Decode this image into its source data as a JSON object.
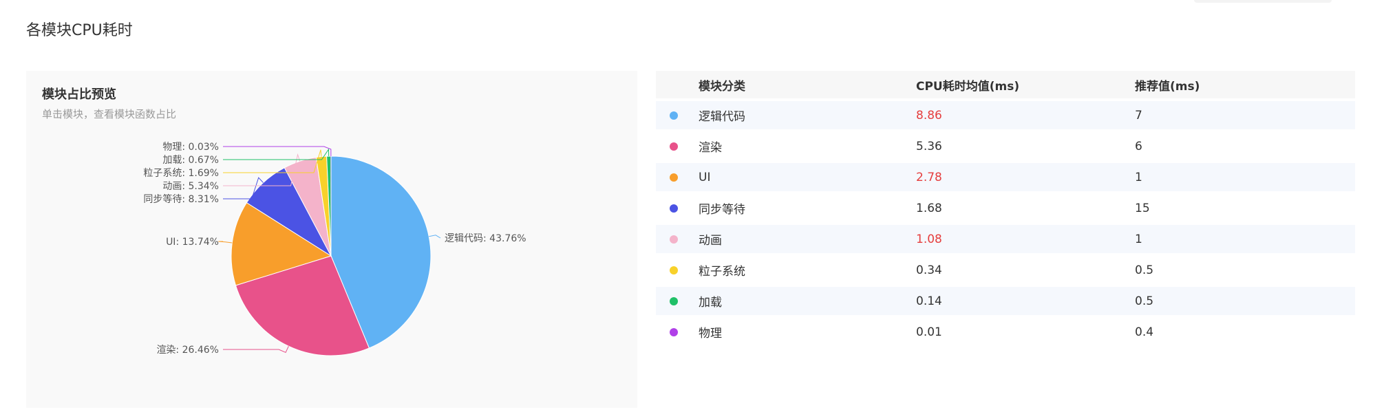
{
  "page": {
    "title": "各模块CPU耗时"
  },
  "card": {
    "title": "模块占比预览",
    "subtitle": "单击模块，查看模块函数占比"
  },
  "chart_data": {
    "type": "pie",
    "title": "模块占比预览",
    "subtitle": "单击模块，查看模块函数占比",
    "slices": [
      {
        "name": "逻辑代码",
        "percent": 43.76,
        "label": "逻辑代码: 43.76%",
        "color": "#60b2f4"
      },
      {
        "name": "渲染",
        "percent": 26.46,
        "label": "渲染: 26.46%",
        "color": "#e8528a"
      },
      {
        "name": "UI",
        "percent": 13.74,
        "label": "UI: 13.74%",
        "color": "#f89e2b"
      },
      {
        "name": "同步等待",
        "percent": 8.31,
        "label": "同步等待: 8.31%",
        "color": "#4b53e4"
      },
      {
        "name": "动画",
        "percent": 5.34,
        "label": "动画: 5.34%",
        "color": "#f4b3ca"
      },
      {
        "name": "粒子系统",
        "percent": 1.69,
        "label": "粒子系统: 1.69%",
        "color": "#f8d12a"
      },
      {
        "name": "加载",
        "percent": 0.67,
        "label": "加载: 0.67%",
        "color": "#20c068"
      },
      {
        "name": "物理",
        "percent": 0.03,
        "label": "物理: 0.03%",
        "color": "#b040e8"
      }
    ]
  },
  "table": {
    "headers": {
      "name": "模块分类",
      "avg": "CPU耗时均值(ms)",
      "rec": "推荐值(ms)"
    },
    "rows": [
      {
        "name": "逻辑代码",
        "avg": "8.86",
        "rec": "7",
        "color": "#60b2f4",
        "over": true
      },
      {
        "name": "渲染",
        "avg": "5.36",
        "rec": "6",
        "color": "#e8528a",
        "over": false
      },
      {
        "name": "UI",
        "avg": "2.78",
        "rec": "1",
        "color": "#f89e2b",
        "over": true
      },
      {
        "name": "同步等待",
        "avg": "1.68",
        "rec": "15",
        "color": "#4b53e4",
        "over": false
      },
      {
        "name": "动画",
        "avg": "1.08",
        "rec": "1",
        "color": "#f4b3ca",
        "over": true
      },
      {
        "name": "粒子系统",
        "avg": "0.34",
        "rec": "0.5",
        "color": "#f8d12a",
        "over": false
      },
      {
        "name": "加载",
        "avg": "0.14",
        "rec": "0.5",
        "color": "#20c068",
        "over": false
      },
      {
        "name": "物理",
        "avg": "0.01",
        "rec": "0.4",
        "color": "#b040e8",
        "over": false
      }
    ],
    "warn_color": "#e53e3e"
  }
}
